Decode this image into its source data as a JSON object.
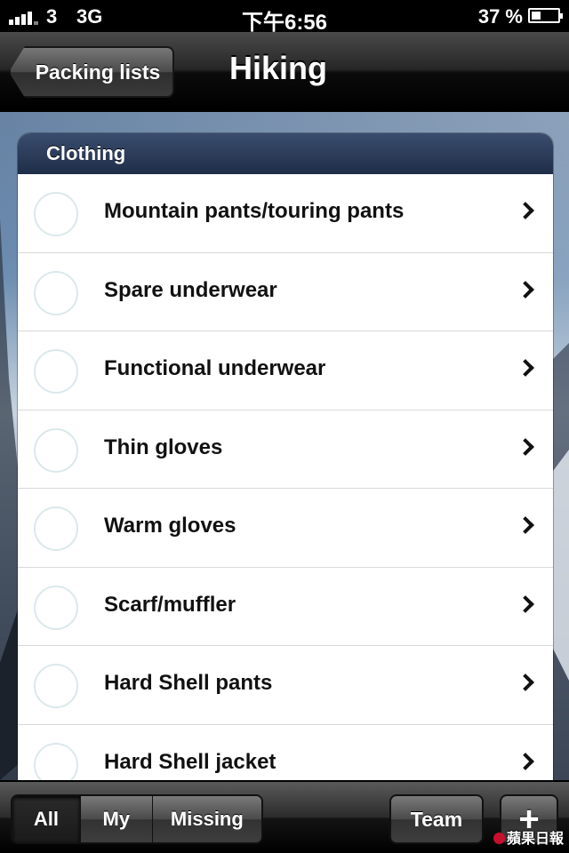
{
  "status_bar": {
    "carrier": "3",
    "network": "3G",
    "time": "下午6:56",
    "battery_percent": "37 %",
    "battery_level": 0.37
  },
  "nav": {
    "back_label": "Packing lists",
    "title": "Hiking"
  },
  "section": {
    "title": "Clothing",
    "items": [
      {
        "label": "Mountain pants/touring pants"
      },
      {
        "label": "Spare underwear"
      },
      {
        "label": "Functional underwear"
      },
      {
        "label": "Thin gloves"
      },
      {
        "label": "Warm gloves"
      },
      {
        "label": "Scarf/muffler"
      },
      {
        "label": "Hard Shell pants"
      },
      {
        "label": "Hard Shell jacket"
      }
    ]
  },
  "toolbar": {
    "filters": [
      {
        "label": "All",
        "selected": true
      },
      {
        "label": "My",
        "selected": false
      },
      {
        "label": "Missing",
        "selected": false
      }
    ],
    "team_label": "Team",
    "add_label": "+"
  },
  "watermark": "蘋果日報",
  "colors": {
    "section_header": "#2b3b58",
    "nav_bar": "#1a1a1a"
  }
}
